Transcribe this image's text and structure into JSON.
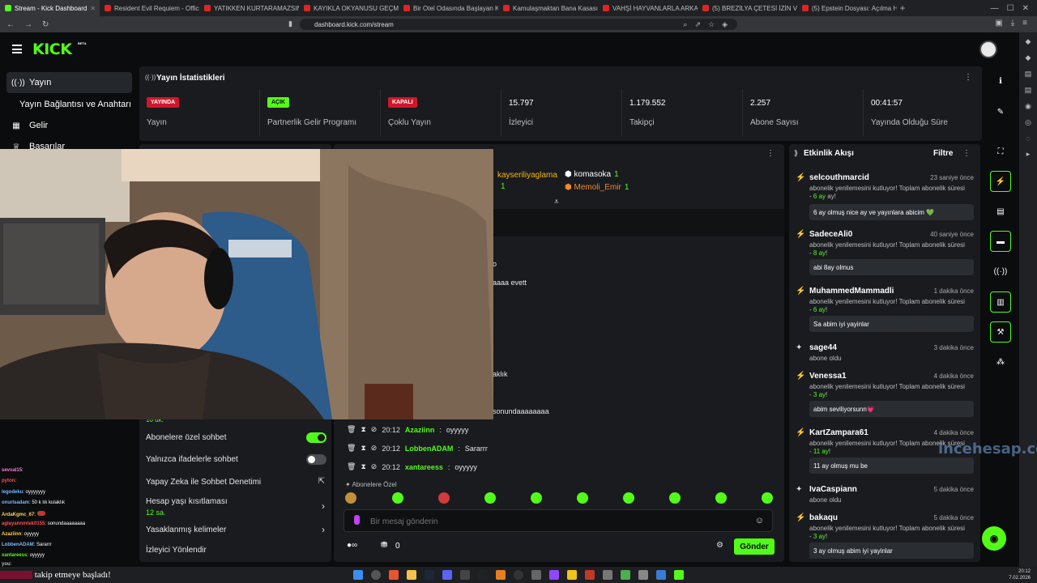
{
  "browser": {
    "tabs": [
      {
        "label": "Stream - Kick Dashboard",
        "active": true
      },
      {
        "label": "Resident Evil Requiem - Official 'Evil",
        "active": false
      },
      {
        "label": "YATIKKEN KURTARAMAZSIN | Süride",
        "active": false
      },
      {
        "label": "KAYIKLA OKYANUSU GEÇMEYE ÇALI",
        "active": false
      },
      {
        "label": "Bir Otel Odasında Başlayan Kabus: Ne",
        "active": false
      },
      {
        "label": "Kamulaşmaktan Bana Kasasına: İsr",
        "active": false
      },
      {
        "label": "VAHŞİ HAYVANLARLA ARKADAŞ OL",
        "active": false
      },
      {
        "label": "(5) BREZİLYA ÇETESİ İZİN VEROR FAVI",
        "active": false
      },
      {
        "label": "(5) Epstein Dosyası: Açılma Her Şey",
        "active": false
      }
    ],
    "url": "dashboard.kick.com/stream"
  },
  "header": {
    "logo": "KICK",
    "logo_badge": "BETA"
  },
  "sidebar": {
    "items": [
      {
        "label": "Yayın",
        "icon": "broadcast-icon"
      },
      {
        "label": "Yayın Bağlantısı ve Anahtarı",
        "icon": ""
      },
      {
        "label": "Gelir",
        "icon": "revenue-icon"
      },
      {
        "label": "Başarılar",
        "icon": "trophy-icon"
      }
    ]
  },
  "stats": {
    "title": "Yayın İstatistikleri",
    "cells": [
      {
        "badge": "YAYINDA",
        "label": "Yayın"
      },
      {
        "badge": "AÇIK",
        "label": "Partnerlik Gelir Programı"
      },
      {
        "badge": "KAPALI",
        "label": "Çoklu Yayın"
      },
      {
        "value": "15.797",
        "label": "İzleyici"
      },
      {
        "value": "1.179.552",
        "label": "Takipçi"
      },
      {
        "value": "2.257",
        "label": "Abone Sayısı"
      },
      {
        "value": "00:41:57",
        "label": "Yayında Olduğu Süre"
      }
    ]
  },
  "settings": {
    "partial_top": "10 dk.",
    "sub_only": "Abonelere özel sohbet",
    "emote_only": "Yalnızca ifadelerle sohbet",
    "ai_mod": "Yapay Zeka ile Sohbet Denetimi",
    "age_restrict": "Hesap yaşı kısıtlaması",
    "age_value": "12 sa.",
    "banned_words": "Yasaklanmış kelimeler",
    "viewer_redirect": "İzleyici Yönlendir"
  },
  "chat": {
    "pinned": [
      {
        "user": "kayseriliyaglama",
        "count": "1"
      },
      {
        "user": "komasoka",
        "count": "1"
      },
      {
        "user": "Memoli_Emir",
        "count": "1"
      }
    ],
    "pinned_extra_count": "1",
    "fragments": [
      "o",
      "aaaa evett",
      "aklık",
      "sonundaaaaaaaa"
    ],
    "messages": [
      {
        "time": "20:12",
        "user": "Azaziinn",
        "text": "oyyyyy"
      },
      {
        "time": "20:12",
        "user": "LobbenADAM",
        "text": "Sararrr"
      },
      {
        "time": "20:12",
        "user": "xantareess",
        "text": "oyyyyy"
      }
    ],
    "emote_section": "Abonelere Özel",
    "input_placeholder": "Bir mesaj gönderin",
    "points": "0",
    "send_label": "Gönder"
  },
  "feed": {
    "title": "Etkinlik Akışı",
    "filter_label": "Filtre",
    "items": [
      {
        "user": "selcouthmarcid",
        "time": "23 saniye önce",
        "desc": "abonelik yenilemesini kutluyor! Toplam abonelik süresi - ",
        "months": "6 ay",
        "msg": "6 ay olmuş nice ay ve yayınlara abicim 💚"
      },
      {
        "user": "SadeceAli0",
        "time": "40 saniye önce",
        "desc": "abonelik yenilemesini kutluyor! Toplam abonelik süresi - ",
        "months": "8 ay",
        "msg": "abi 8ay olmus"
      },
      {
        "user": "MuhammedMammadli",
        "time": "1 dakika önce",
        "desc": "abonelik yenilemesini kutluyor! Toplam abonelik süresi - ",
        "months": "6 ay",
        "msg": "Sa abim iyi yayinlar"
      },
      {
        "user": "sage44",
        "time": "3 dakika önce",
        "desc": "abone oldu"
      },
      {
        "user": "Venessa1",
        "time": "4 dakika önce",
        "desc": "abonelik yenilemesini kutluyor! Toplam abonelik süresi - ",
        "months": "3 ay",
        "msg": "abim seviliyorsunn💗"
      },
      {
        "user": "KartZampara61",
        "time": "4 dakika önce",
        "desc": "abonelik yenilemesini kutluyor! Toplam abonelik süresi - ",
        "months": "11 ay",
        "msg": "11 ay olmuş mu be"
      },
      {
        "user": "IvaCaspiann",
        "time": "5 dakika önce",
        "desc": "abone oldu"
      },
      {
        "user": "bakaqu",
        "time": "5 dakika önce",
        "desc": "abonelik yenilemesini kutluyor! Toplam abonelik süresi - ",
        "months": "3 ay",
        "msg": "3 ay olmuş abim iyi yayinlar"
      }
    ]
  },
  "overlay": {
    "lines": [
      {
        "user": "sevval15",
        "text": ": "
      },
      {
        "user": "pyton",
        "text": ": "
      },
      {
        "user": "legodeku",
        "text": ": oyyyyyyy"
      },
      {
        "user": "onurlsadam",
        "text": ": 50 k lık kulaklık"
      },
      {
        "user": "ArdaKgmc_67",
        "text": ": "
      },
      {
        "user": "aglayannmtek0155",
        "text": ": sonundaaaaaaaa"
      },
      {
        "user": "Azaziinn",
        "text": ": oyyyyy"
      },
      {
        "user": "LobbenADAM",
        "text": ": Sararrr"
      },
      {
        "user": "xantareess",
        "text": ": oyyyyy"
      },
      {
        "user": "you",
        "text": ": "
      }
    ],
    "follow_text": "takip etmeye başladı!",
    "watermark": "incehesap.com"
  },
  "taskbar": {
    "time": "20:12",
    "date": "7.02.2026"
  },
  "colors": {
    "accent": "#53fc18",
    "live_red": "#d2162a",
    "panel": "#191b1f",
    "background": "#0b0c0d"
  }
}
